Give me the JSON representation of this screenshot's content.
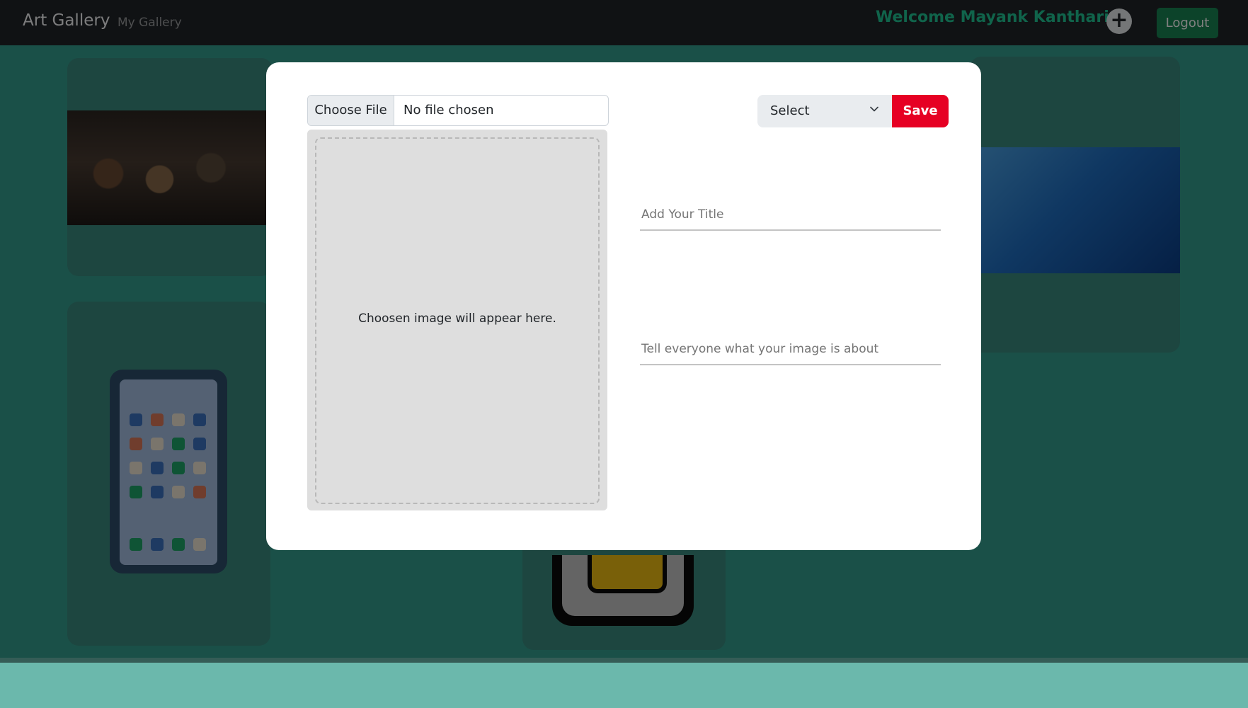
{
  "navbar": {
    "brand": "Art Gallery",
    "nav_link": "My Gallery",
    "welcome": "Welcome Mayank Kantharia",
    "add_icon": "plus-circle-icon",
    "logout_label": "Logout"
  },
  "modal": {
    "file_button_label": "Choose File",
    "file_status": "No file chosen",
    "preview_text": "Choosen image will appear here.",
    "select_label": "Select",
    "save_label": "Save",
    "title_placeholder": "Add Your Title",
    "description_placeholder": "Tell everyone what your image is about"
  },
  "colors": {
    "accent": "#e60023",
    "welcome": "#20c997",
    "logout": "#198754",
    "navbar": "#212529"
  }
}
